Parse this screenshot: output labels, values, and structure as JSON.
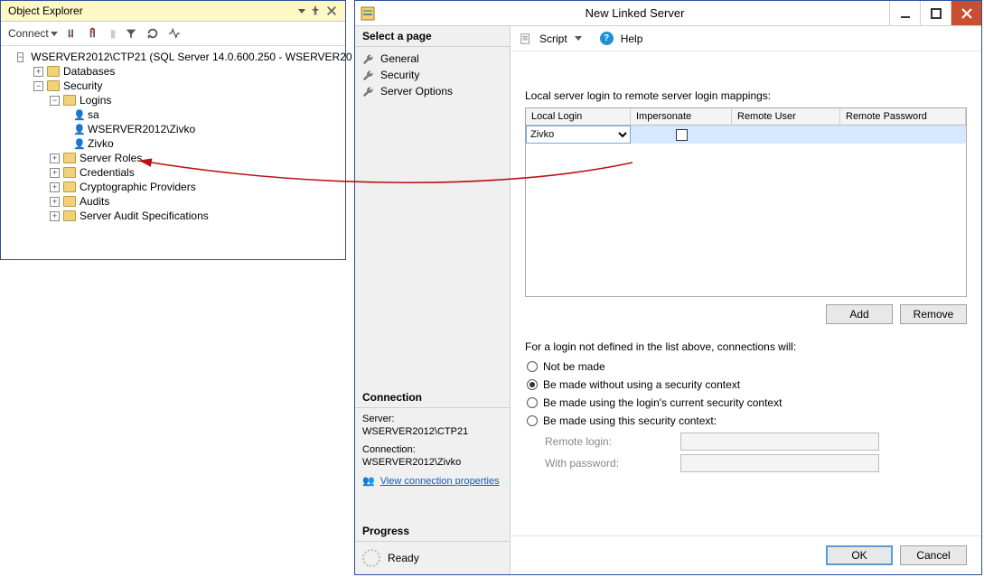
{
  "objectExplorer": {
    "title": "Object Explorer",
    "connectLabel": "Connect",
    "tree": {
      "server": "WSERVER2012\\CTP21 (SQL Server 14.0.600.250 - WSERVER20",
      "databases": "Databases",
      "security": "Security",
      "logins": "Logins",
      "loginItems": [
        "sa",
        "WSERVER2012\\Zivko",
        "Zivko"
      ],
      "serverRoles": "Server Roles",
      "credentials": "Credentials",
      "cryptoProviders": "Cryptographic Providers",
      "audits": "Audits",
      "serverAuditSpecs": "Server Audit Specifications"
    }
  },
  "dialog": {
    "title": "New Linked Server",
    "selectPage": "Select a page",
    "pages": [
      "General",
      "Security",
      "Server Options"
    ],
    "connection": {
      "header": "Connection",
      "serverLabel": "Server:",
      "serverValue": "WSERVER2012\\CTP21",
      "connLabel": "Connection:",
      "connValue": "WSERVER2012\\Zivko",
      "viewProps": "View connection properties"
    },
    "progress": {
      "header": "Progress",
      "status": "Ready"
    },
    "toolbar": {
      "script": "Script",
      "help": "Help"
    },
    "mappingsLabel": "Local server login to remote server login mappings:",
    "gridHeaders": {
      "localLogin": "Local Login",
      "impersonate": "Impersonate",
      "remoteUser": "Remote User",
      "remotePassword": "Remote Password"
    },
    "gridRow": {
      "selectedLogin": "Zivko"
    },
    "addBtn": "Add",
    "removeBtn": "Remove",
    "radioIntro": "For a login not defined in the list above, connections will:",
    "radios": {
      "notMade": "Not be made",
      "noSecurity": "Be made without using a security context",
      "currentSecurity": "Be made using the login's current security context",
      "thisSecurity": "Be made using this security context:"
    },
    "remoteLoginLabel": "Remote login:",
    "withPasswordLabel": "With password:",
    "okBtn": "OK",
    "cancelBtn": "Cancel"
  }
}
